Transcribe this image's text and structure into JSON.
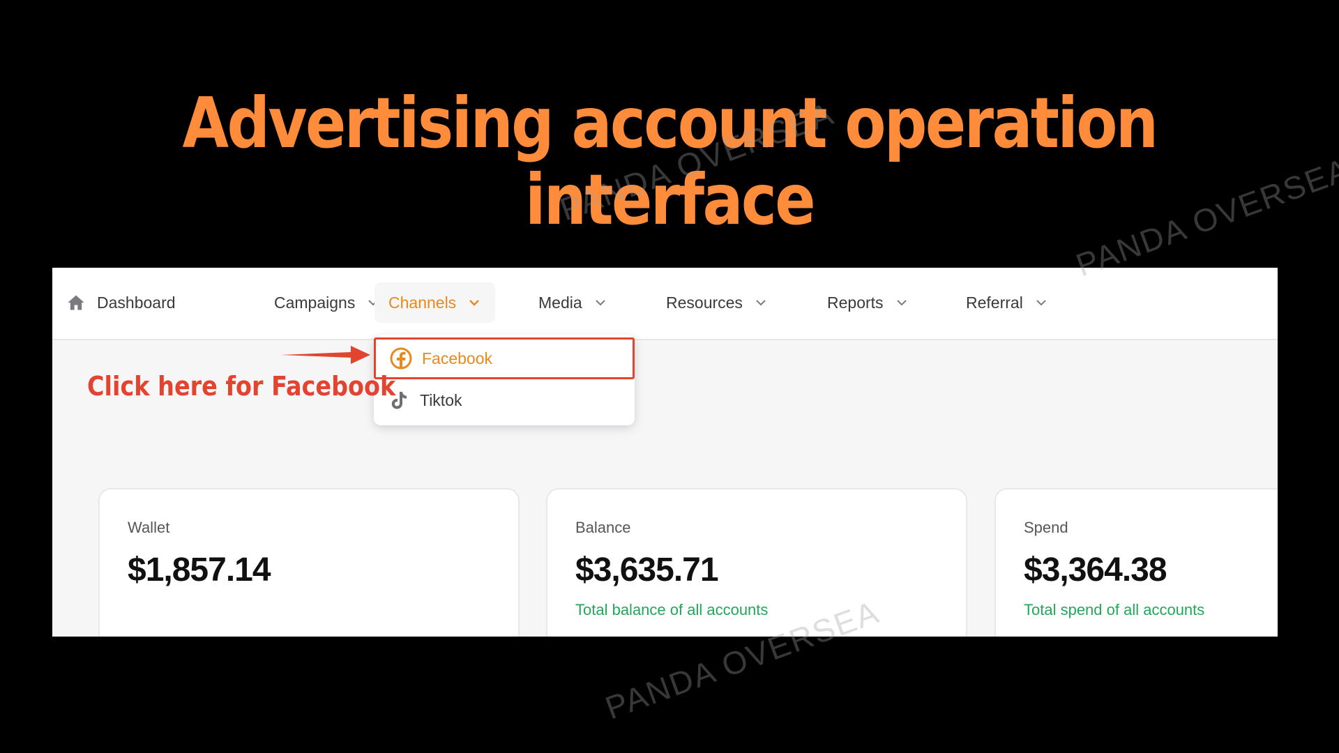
{
  "headline": "Advertising account operation interface",
  "watermark": "PANDA OVERSEA",
  "nav": {
    "items": [
      {
        "label": "Dashboard",
        "icon": "home-icon"
      },
      {
        "label": "Campaigns"
      },
      {
        "label": "Channels",
        "active": true
      },
      {
        "label": "Media"
      },
      {
        "label": "Resources"
      },
      {
        "label": "Reports"
      },
      {
        "label": "Referral"
      }
    ]
  },
  "dropdown": {
    "items": [
      {
        "label": "Facebook",
        "icon": "facebook-icon",
        "highlighted": true
      },
      {
        "label": "Tiktok",
        "icon": "tiktok-icon"
      }
    ]
  },
  "callout": "Click here for Facebook",
  "cards": [
    {
      "label": "Wallet",
      "value": "$1,857.14",
      "note": ""
    },
    {
      "label": "Balance",
      "value": "$3,635.71",
      "note": "Total balance of all accounts"
    },
    {
      "label": "Spend",
      "value": "$3,364.38",
      "note": "Total spend of all accounts"
    }
  ],
  "colors": {
    "headline": "#ff8c3a",
    "accent": "#e8891d",
    "highlight_border": "#e2442f",
    "positive_text": "#1fa85a",
    "background": "#000000"
  }
}
